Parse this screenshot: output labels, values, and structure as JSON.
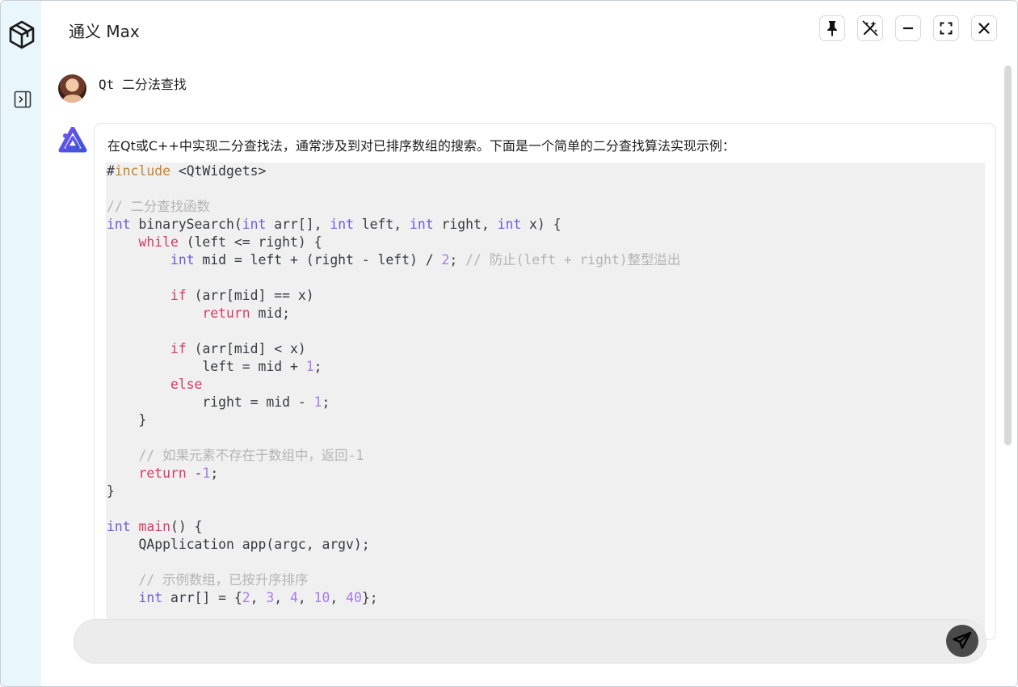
{
  "window": {
    "title": "通义 Max",
    "buttons": [
      {
        "name": "pin-icon"
      },
      {
        "name": "no-magic-icon"
      },
      {
        "name": "minimize-icon"
      },
      {
        "name": "fullscreen-icon"
      },
      {
        "name": "close-icon"
      }
    ]
  },
  "sidebar": {
    "logo_icon": "cube-logo-icon",
    "toggle_icon": "panel-expand-icon"
  },
  "conversation": {
    "user_message": "Qt 二分法查找",
    "assistant_intro": "在Qt或C++中实现二分查找法，通常涉及到对已排序数组的搜索。下面是一个简单的二分查找算法实现示例：",
    "code": {
      "include_hash": "#",
      "include_kw": "include",
      "include_target": " <QtWidgets>",
      "comment_binary": "// 二分查找函数",
      "sig_int": "int",
      "sig_name": " binarySearch(",
      "sig_int2": "int",
      "sig_arr": " arr[], ",
      "sig_int3": "int",
      "sig_left": " left, ",
      "sig_int4": "int",
      "sig_right": " right, ",
      "sig_int5": "int",
      "sig_end": " x) {",
      "while_kw": "while",
      "while_rest": " (left <= right) {",
      "mid_int": "int",
      "mid_rest": " mid = left + (right - left) / ",
      "mid_num": "2",
      "mid_semi": "; ",
      "mid_comment": "// 防止(left + right)整型溢出",
      "if1_kw": "if",
      "if1_rest": " (arr[mid] == x)",
      "ret_kw": "return",
      "ret_rest": " mid;",
      "if2_kw": "if",
      "if2_rest": " (arr[mid] < x)",
      "left_assign": "left = mid + ",
      "left_num": "1",
      "left_semi": ";",
      "else_kw": "else",
      "right_assign": "right = mid - ",
      "right_num": "1",
      "right_semi": ";",
      "close_while": "}",
      "comment_notfound": "// 如果元素不存在于数组中，返回-1",
      "ret2_kw": "return",
      "ret2_space": " -",
      "ret2_num": "1",
      "ret2_semi": ";",
      "close_func": "}",
      "main_int": "int",
      "main_name": " main",
      "main_rest": "() {",
      "qapp": "QApplication app(argc, argv);",
      "comment_array": "// 示例数组，已按升序排序",
      "arr_int": "int",
      "arr_rest": " arr[] = {",
      "arr_n1": "2",
      "arr_c1": ", ",
      "arr_n2": "3",
      "arr_c2": ", ",
      "arr_n3": "4",
      "arr_c3": ", ",
      "arr_n4": "10",
      "arr_c4": ", ",
      "arr_n5": "40",
      "arr_end": "};"
    }
  },
  "composer": {
    "placeholder": "",
    "send_icon": "send-icon"
  },
  "colors": {
    "sidebar_bg": "#e9f6fc",
    "code_bg": "#f0f0f0",
    "keyword": "#6a5fd3",
    "control": "#d93a63",
    "number": "#a77be8",
    "comment": "#b4b4b4",
    "preprocessor": "#c4832f"
  }
}
